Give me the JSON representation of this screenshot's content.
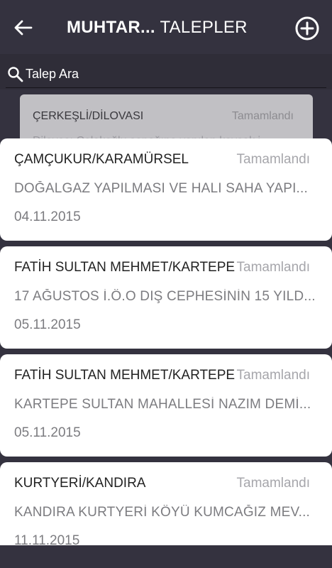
{
  "header": {
    "title_bold": "MUHTAR...",
    "title_rest": " TALEPLER",
    "back_icon": "arrow-left-icon",
    "add_icon": "plus-circle-icon"
  },
  "search": {
    "placeholder": "Talep Ara"
  },
  "background_item": {
    "location": "ÇERKEŞLİ/DİLOVASI",
    "status": "Tamamlandı",
    "description": "Dilovası Çolakoğlu sapağına yapılan kavşak i"
  },
  "items": [
    {
      "location": "ÇAMÇUKUR/KARAMÜRSEL",
      "status": "Tamamlandı",
      "description": "DOĞALGAZ YAPILMASI VE HALI SAHA YAPI...",
      "date": "04.11.2015"
    },
    {
      "location": "FATİH SULTAN MEHMET/KARTEPE",
      "status": "Tamamlandı",
      "description": "17 AĞUSTOS İ.Ö.O DIŞ CEPHESİNİN 15 YILD...",
      "date": "05.11.2015"
    },
    {
      "location": "FATİH SULTAN MEHMET/KARTEPE",
      "status": "Tamamlandı",
      "description": "KARTEPE SULTAN MAHALLESİ NAZIM DEMİ...",
      "date": "05.11.2015"
    },
    {
      "location": "KURTYERİ/KANDIRA",
      "status": "Tamamlandı",
      "description": "KANDIRA KURTYERİ KÖYÜ KUMCAĞIZ MEV...",
      "date": "11.11.2015"
    }
  ]
}
